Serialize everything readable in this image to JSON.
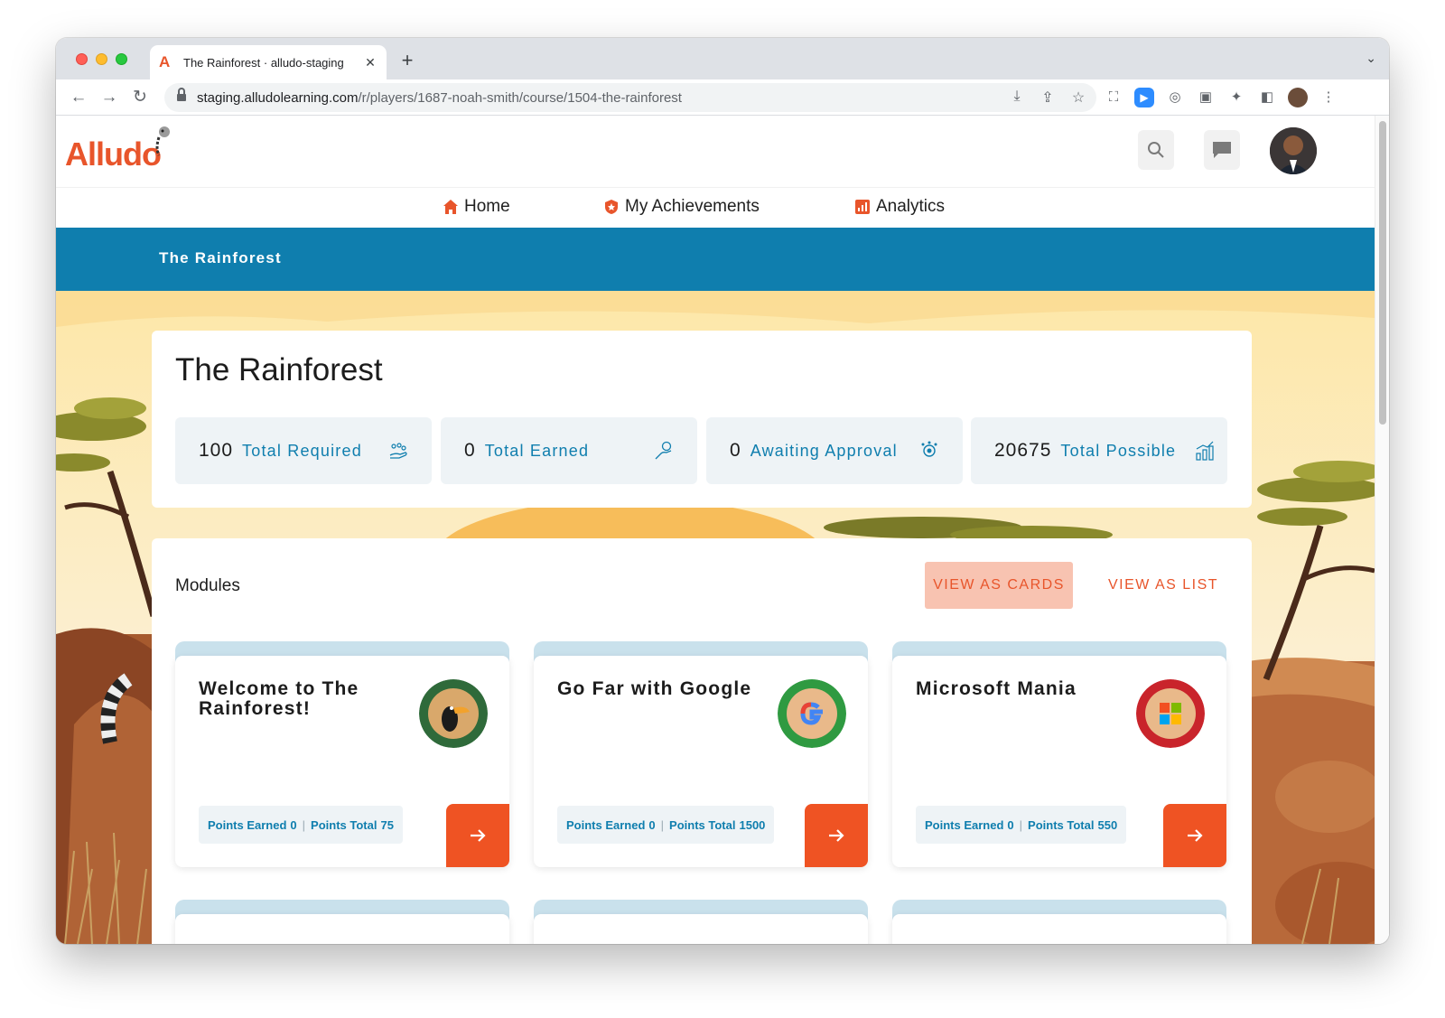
{
  "browser": {
    "tab_title": "The Rainforest · alludo-staging",
    "tab_favicon": "A",
    "close_glyph": "✕",
    "new_tab_glyph": "+",
    "tab_menu_glyph": "⌄",
    "url_host": "staging.alludolearning.com",
    "url_path": "/r/players/1687-noah-smith/course/1504-the-rainforest"
  },
  "site": {
    "logo_text": "Alludo",
    "nav": [
      {
        "label": "Home",
        "icon": "home-icon"
      },
      {
        "label": "My Achievements",
        "icon": "badge-icon"
      },
      {
        "label": "Analytics",
        "icon": "chart-icon"
      }
    ],
    "breadcrumb_title": "The Rainforest"
  },
  "course": {
    "title": "The Rainforest",
    "stats": [
      {
        "value": "100",
        "label": "Total Required",
        "icon": "hand-coins-icon"
      },
      {
        "value": "0",
        "label": "Total Earned",
        "icon": "hand-heart-icon"
      },
      {
        "value": "0",
        "label": "Awaiting Approval",
        "icon": "ribbon-icon"
      },
      {
        "value": "20675",
        "label": "Total Possible",
        "icon": "growth-chart-icon"
      }
    ]
  },
  "modules": {
    "heading": "Modules",
    "view_cards_label": "VIEW AS CARDS",
    "view_list_label": "VIEW AS LIST",
    "items": [
      {
        "title": "Welcome to The Rainforest!",
        "earned_label": "Points Earned",
        "earned": "0",
        "total_label": "Points Total",
        "total": "75",
        "badge_color": "#2f6a3a",
        "badge_name": "toucan-badge"
      },
      {
        "title": "Go Far with Google",
        "earned_label": "Points Earned",
        "earned": "0",
        "total_label": "Points Total",
        "total": "1500",
        "badge_color": "#2f9a41",
        "badge_name": "google-badge"
      },
      {
        "title": "Microsoft Mania",
        "earned_label": "Points Earned",
        "earned": "0",
        "total_label": "Points Total",
        "total": "550",
        "badge_color": "#c9242b",
        "badge_name": "microsoft-badge"
      }
    ]
  },
  "colors": {
    "accent": "#e8552b",
    "primary_blue": "#0f7eae",
    "go_button": "#ef5323"
  }
}
